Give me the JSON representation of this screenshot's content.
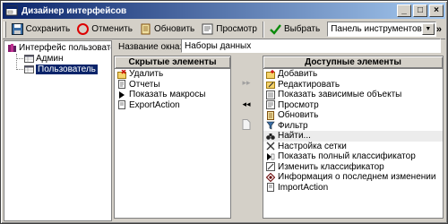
{
  "window": {
    "title": "Дизайнер интерфейсов"
  },
  "title_buttons": {
    "minimize": "_",
    "maximize": "□",
    "close": "×"
  },
  "toolbar": {
    "save": "Сохранить",
    "cancel": "Отменить",
    "refresh": "Обновить",
    "preview": "Просмотр",
    "select": "Выбрать",
    "panel_combo": "Панель инструментов",
    "more": "»"
  },
  "tree": {
    "root": "Интерфейс пользователя",
    "children": [
      "Админ",
      "Пользователь"
    ]
  },
  "form": {
    "window_name_label": "Название окна:",
    "window_name_value": "Наборы данных"
  },
  "hidden_panel": {
    "header": "Скрытые элементы",
    "items": [
      "Удалить",
      "Отчеты",
      "Показать макросы",
      "ExportAction"
    ]
  },
  "available_panel": {
    "header": "Доступные элементы",
    "items": [
      "Добавить",
      "Редактировать",
      "Показать зависимые объекты",
      "Просмотр",
      "Обновить",
      "Фильтр",
      "Найти...",
      "Настройка сетки",
      "Показать полный классификатор",
      "Изменить классификатор",
      "Информация о последнем изменении",
      "ImportAction"
    ]
  },
  "mid_buttons": {
    "move_all_right": "▸▸",
    "move_left": "◂◂"
  }
}
